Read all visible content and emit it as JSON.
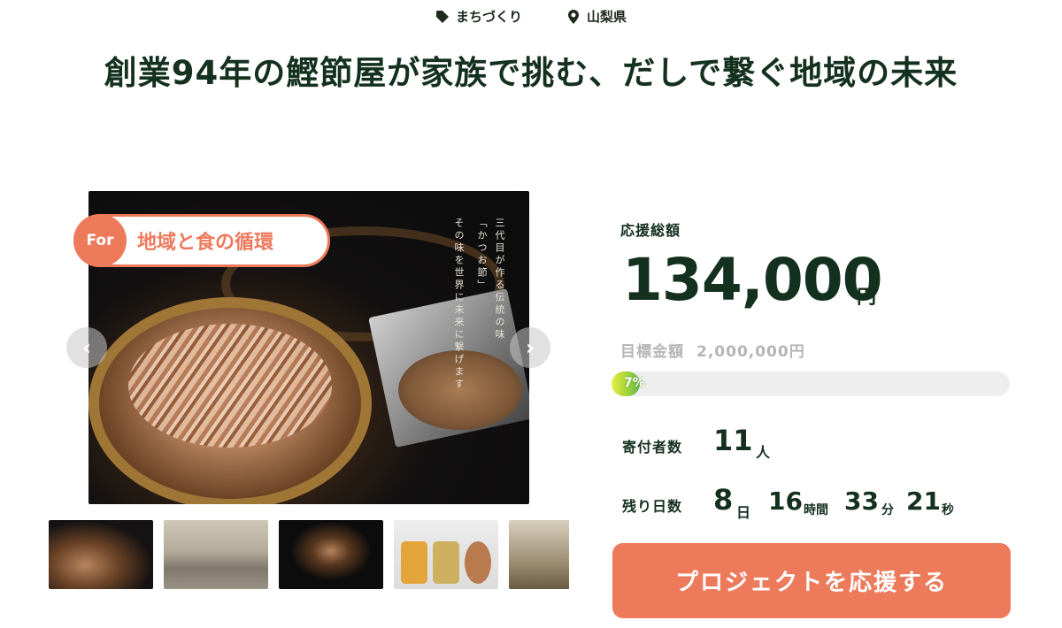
{
  "tags": [
    {
      "icon": "tag-icon",
      "label": "まちづくり"
    },
    {
      "icon": "location-pin-icon",
      "label": "山梨県"
    }
  ],
  "title": "創業94年の鰹節屋が家族で挑む、だしで繋ぐ地域の未来",
  "main_image": {
    "badge_prefix": "For",
    "badge_text": "地域と食の循環",
    "vertical_text": [
      "三代目が作る伝統の味",
      "「かつお節」",
      "その味を世界に未来に繋げます"
    ]
  },
  "carousel": {
    "prev_icon": "chevron-left-icon",
    "next_icon": "chevron-right-icon",
    "thumbnail_count": 5
  },
  "funding": {
    "total_label": "応援総額",
    "total_amount": "134,000",
    "total_unit": "円",
    "goal_label": "目標金額",
    "goal_value": "2,000,000円",
    "progress_percent": 7,
    "progress_text": "7%",
    "supporters_label": "寄付者数",
    "supporters_count": "11",
    "supporters_unit": "人",
    "remaining_label": "残り日数",
    "remaining": {
      "days": "8",
      "days_unit": "日",
      "hours": "16",
      "hours_unit": "時間",
      "minutes": "33",
      "minutes_unit": "分",
      "seconds": "21",
      "seconds_unit": "秒"
    }
  },
  "cta_label": "プロジェクトを応援する",
  "colors": {
    "accent": "#ee7a5c",
    "text_dark": "#14301f",
    "muted": "#b5b5b5",
    "progress": "#9bd13a"
  }
}
